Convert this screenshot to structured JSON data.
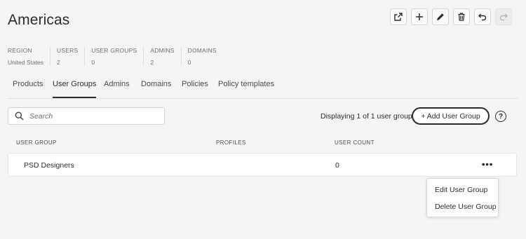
{
  "page": {
    "title": "Americas"
  },
  "toolbar": {
    "buttons": [
      {
        "name": "open-external",
        "icon": "external-link-icon"
      },
      {
        "name": "add",
        "icon": "plus-icon"
      },
      {
        "name": "edit",
        "icon": "pencil-icon"
      },
      {
        "name": "delete",
        "icon": "trash-icon"
      },
      {
        "name": "undo",
        "icon": "undo-icon"
      },
      {
        "name": "redo",
        "icon": "redo-icon",
        "disabled": true
      }
    ]
  },
  "stats": [
    {
      "label": "REGION",
      "value": "United States"
    },
    {
      "label": "USERS",
      "value": "2"
    },
    {
      "label": "USER GROUPS",
      "value": "0"
    },
    {
      "label": "ADMINS",
      "value": "2"
    },
    {
      "label": "DOMAINS",
      "value": "0"
    }
  ],
  "tabs": [
    {
      "label": "Products",
      "active": false
    },
    {
      "label": "User Groups",
      "active": true
    },
    {
      "label": "Admins",
      "active": false
    },
    {
      "label": "Domains",
      "active": false
    },
    {
      "label": "Policies",
      "active": false
    },
    {
      "label": "Policy templates",
      "active": false
    }
  ],
  "search": {
    "placeholder": "Search",
    "value": ""
  },
  "list": {
    "displaying": "Displaying 1 of 1 user groups",
    "add_button": "+ Add User Group",
    "help": "?",
    "columns": [
      "USER GROUP",
      "PROFILES",
      "USER COUNT"
    ],
    "rows": [
      {
        "name": "PSD Designers",
        "profiles": "",
        "count": "0",
        "more": "•••"
      }
    ]
  },
  "context_menu": {
    "items": [
      "Edit User Group",
      "Delete User Group"
    ]
  },
  "colors": {
    "text": "#2c2c2c",
    "background": "#f5f5f5",
    "surface": "#ffffff",
    "border": "#e1e1e1"
  }
}
